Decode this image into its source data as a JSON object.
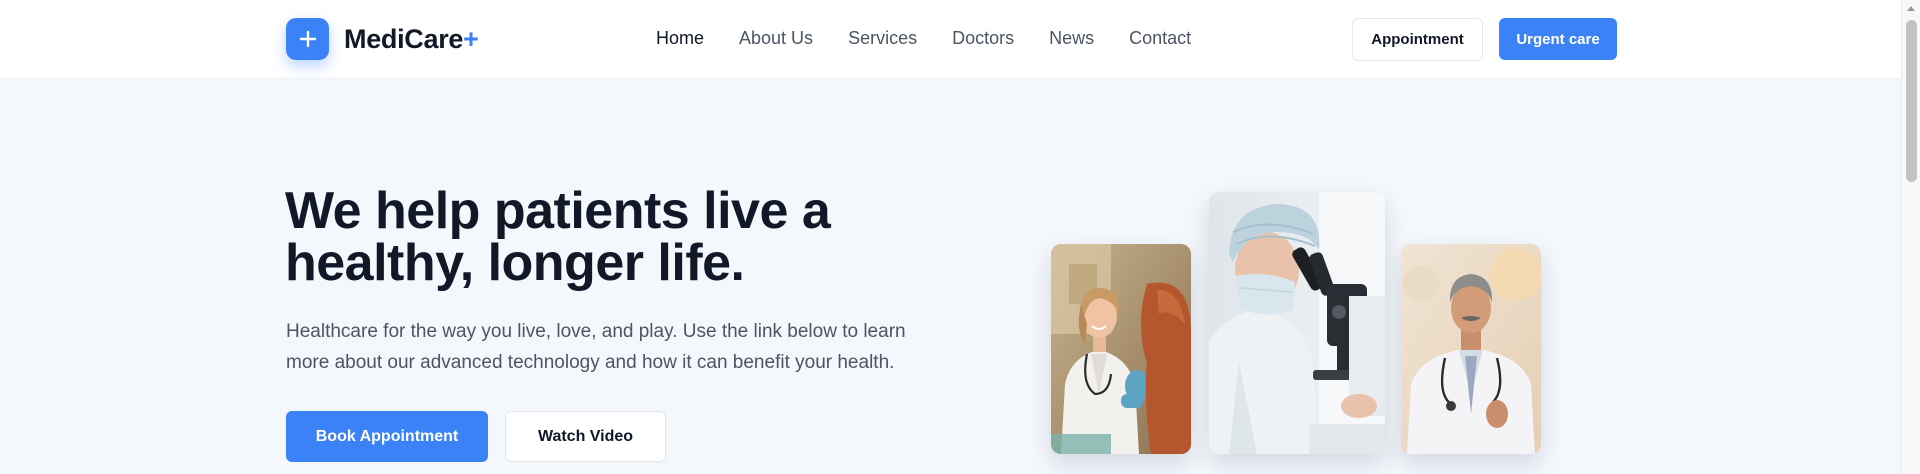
{
  "brand": {
    "name": "MediCare",
    "plus": "+"
  },
  "nav": {
    "items": [
      {
        "label": "Home",
        "active": true
      },
      {
        "label": "About Us"
      },
      {
        "label": "Services"
      },
      {
        "label": "Doctors"
      },
      {
        "label": "News"
      },
      {
        "label": "Contact"
      }
    ]
  },
  "header_actions": {
    "appointment": "Appointment",
    "urgent": "Urgent care"
  },
  "hero": {
    "title": "We help patients live a healthy, longer life.",
    "subtitle": "Healthcare for the way you live, love, and play. Use the link below to learn more about our advanced technology and how it can benefit your health.",
    "primary_cta": "Book Appointment",
    "secondary_cta": "Watch Video"
  },
  "photos": [
    {
      "subject": "smiling female doctor with patient"
    },
    {
      "subject": "lab researcher at microscope"
    },
    {
      "subject": "senior male doctor with stethoscope"
    }
  ],
  "colors": {
    "accent": "#3b82f6",
    "text": "#111827",
    "muted": "#4b5563",
    "hero_bg": "#f4f8fd"
  }
}
